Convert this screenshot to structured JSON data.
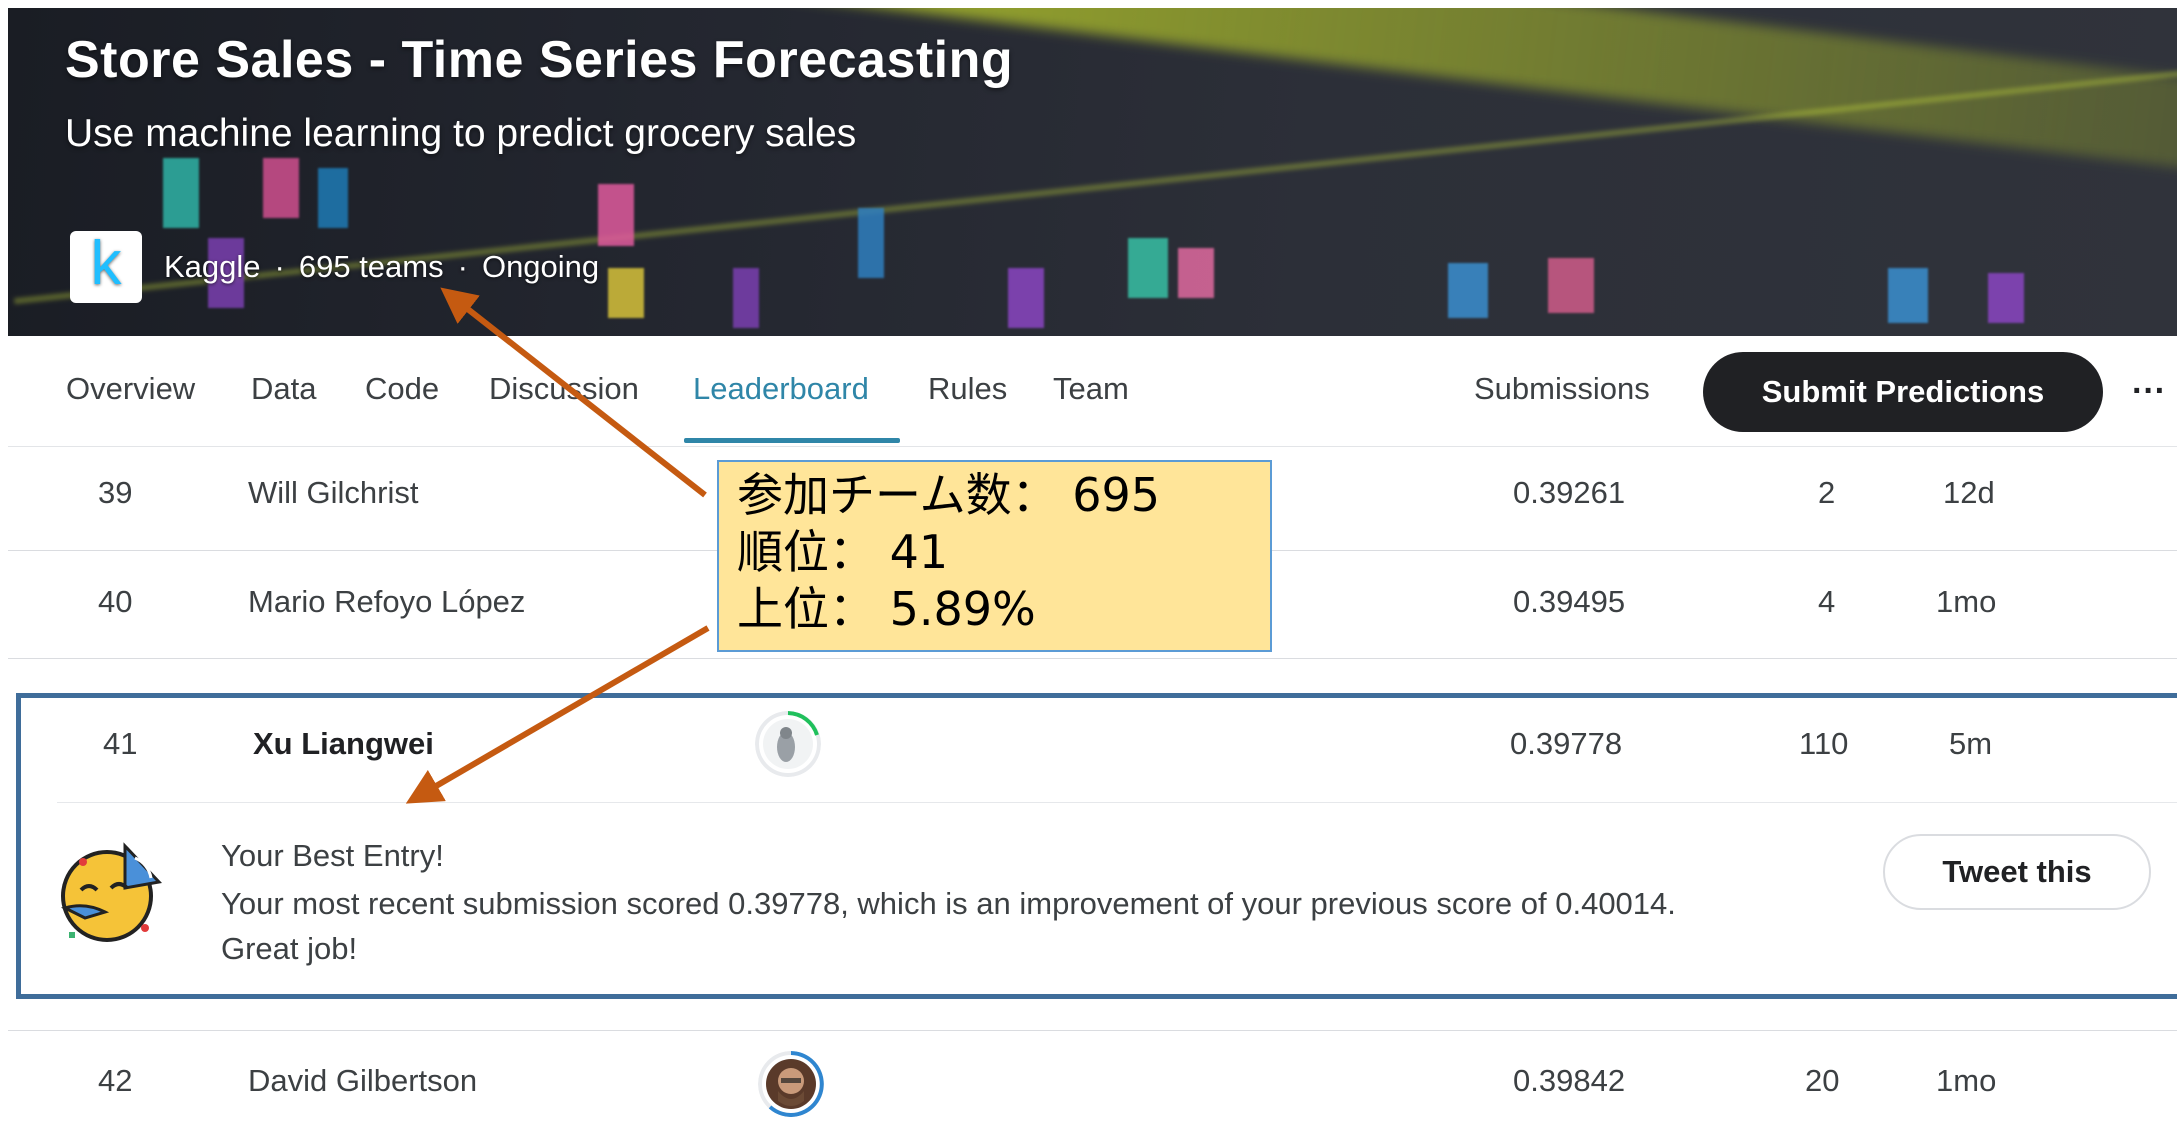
{
  "hero": {
    "title": "Store Sales - Time Series Forecasting",
    "subtitle": "Use machine learning to predict grocery sales",
    "logo_letter": "k",
    "host": "Kaggle",
    "teams": "695 teams",
    "status": "Ongoing",
    "separator": "·"
  },
  "tabs": [
    {
      "label": "Overview"
    },
    {
      "label": "Data"
    },
    {
      "label": "Code"
    },
    {
      "label": "Discussion"
    },
    {
      "label": "Leaderboard",
      "active": true
    },
    {
      "label": "Rules"
    },
    {
      "label": "Team"
    }
  ],
  "nav_right": {
    "submissions": "Submissions",
    "submit_predictions": "Submit Predictions",
    "more": "···"
  },
  "leaderboard": {
    "rows": [
      {
        "rank": "39",
        "name": "Will Gilchrist",
        "score": "0.39261",
        "entries": "2",
        "last": "12d"
      },
      {
        "rank": "40",
        "name": "Mario Refoyo López",
        "score": "0.39495",
        "entries": "4",
        "last": "1mo"
      },
      {
        "rank": "41",
        "name": "Xu Liangwei",
        "score": "0.39778",
        "entries": "110",
        "last": "5m"
      },
      {
        "rank": "42",
        "name": "David Gilbertson",
        "score": "0.39842",
        "entries": "20",
        "last": "1mo"
      }
    ]
  },
  "best_entry": {
    "title": "Your Best Entry!",
    "message": "Your most recent submission scored 0.39778, which is an improvement of your previous score of 0.40014. Great job!",
    "tweet": "Tweet this"
  },
  "callout": {
    "line1": "参加チーム数： 695",
    "line2": "順位： 41",
    "line3": "上位： 5.89%"
  },
  "colors": {
    "accent": "#2f86a8",
    "dark_button": "#202124",
    "highlight_border": "#3f6d9a",
    "callout_bg": "#ffe599",
    "arrow": "#c55a11"
  }
}
